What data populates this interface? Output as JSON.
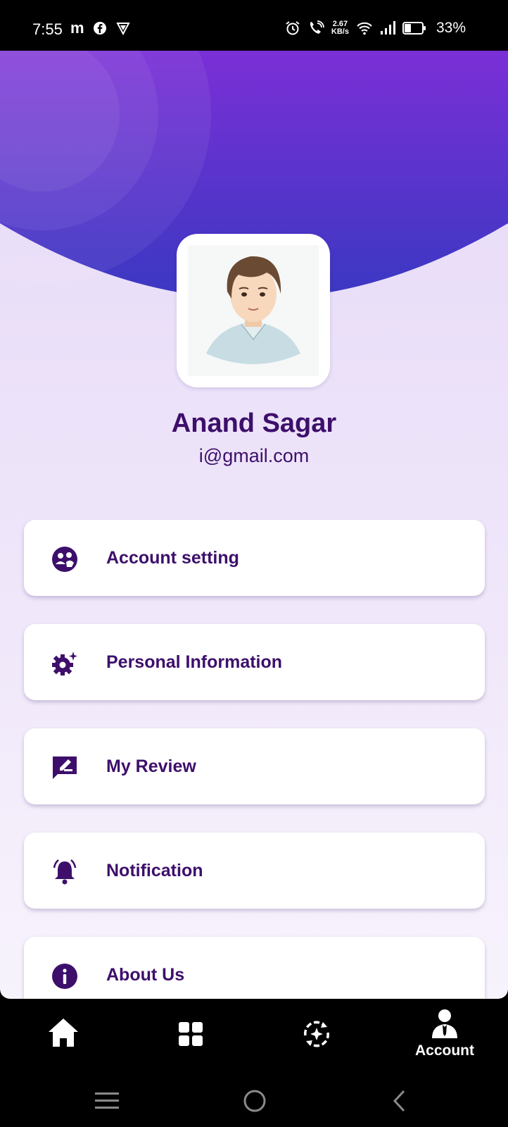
{
  "status_bar": {
    "time": "7:55",
    "net_speed_value": "2.67",
    "net_speed_unit": "KB/s",
    "battery": "33%",
    "left_icons": [
      "m-app-icon",
      "facebook-icon",
      "vpn-shield-icon"
    ],
    "right_icons": [
      "alarm-icon",
      "wifi-call-icon",
      "wifi-icon",
      "signal-icon",
      "battery-icon"
    ]
  },
  "profile": {
    "name": "Anand Sagar",
    "email": "i@gmail.com"
  },
  "menu": [
    {
      "label": "Account setting",
      "icon": "account-setting-icon"
    },
    {
      "label": "Personal Information",
      "icon": "gear-sparkle-icon"
    },
    {
      "label": "My Review",
      "icon": "review-edit-icon"
    },
    {
      "label": "Notification",
      "icon": "bell-icon"
    },
    {
      "label": "About Us",
      "icon": "info-icon"
    }
  ],
  "bottom_nav": {
    "items": [
      "home-icon",
      "grid-icon",
      "refresh-star-icon",
      "account-icon"
    ],
    "account_label": "Account",
    "active": "account"
  },
  "system_nav": [
    "recent-apps-icon",
    "home-circle-icon",
    "back-icon"
  ],
  "colors": {
    "accent_text": "#3d0f6b",
    "header_top": "#7b2fd6",
    "header_bottom": "#3a38c2",
    "page_bg": "#ece2f8"
  }
}
